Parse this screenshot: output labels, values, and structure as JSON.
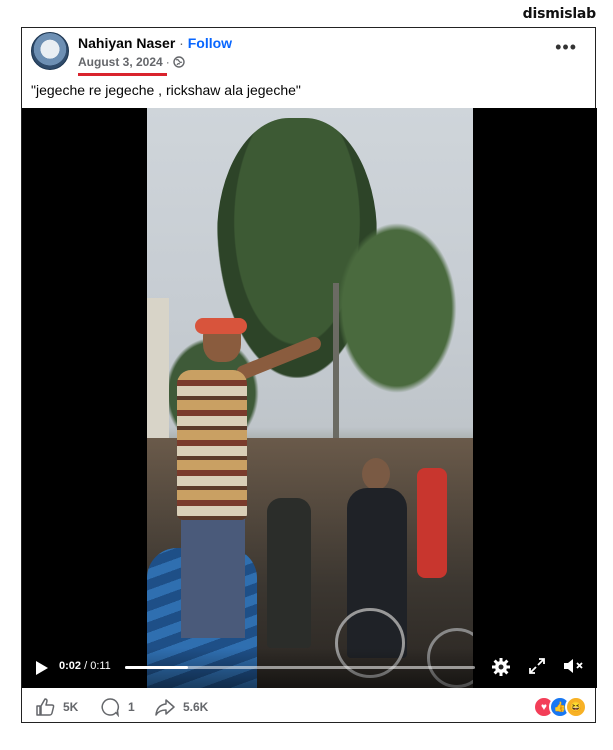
{
  "brand": "dismislab",
  "post": {
    "author": "Nahiyan Naser",
    "separator": "·",
    "follow_label": "Follow",
    "date": "August 3, 2024",
    "meta_separator": "·",
    "privacy_icon": "globe-icon",
    "caption": "\"jegeche re jegeche , rickshaw ala jegeche\""
  },
  "video": {
    "current_time": "0:02",
    "time_separator": " / ",
    "duration": "0:11",
    "progress_fraction": 0.18,
    "icons": [
      "play-icon",
      "settings-icon",
      "fullscreen-icon",
      "mute-icon"
    ]
  },
  "footer": {
    "likes": "5K",
    "comments": "1",
    "shares": "5.6K",
    "reaction_icons": [
      "love-icon",
      "like-icon",
      "haha-icon"
    ]
  },
  "colors": {
    "follow": "#0866ff",
    "highlight_underline": "#d9232d",
    "love": "#f33e58",
    "like": "#1877f2",
    "haha": "#f7b125"
  }
}
